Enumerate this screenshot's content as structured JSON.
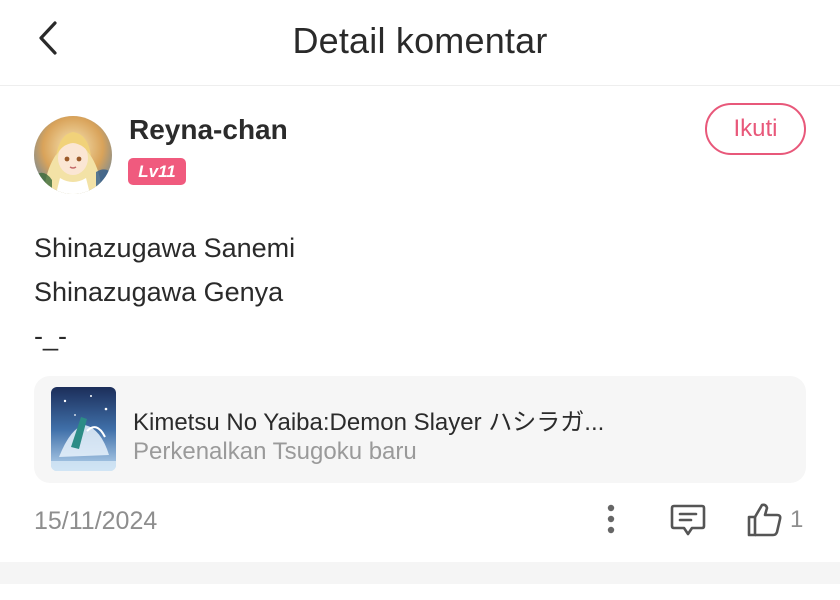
{
  "header": {
    "title": "Detail komentar",
    "back_icon": "chevron-left-icon"
  },
  "comment": {
    "user": {
      "name": "Reyna-chan",
      "level": "Lv11",
      "avatar_icon": "user-avatar"
    },
    "follow_label": "Ikuti",
    "lines": [
      "Shinazugawa Sanemi",
      "Shinazugawa Genya",
      "-_-"
    ],
    "game": {
      "title": "Kimetsu No Yaiba:Demon Slayer ハシラガ...",
      "subtitle": "Perkenalkan Tsugoku baru",
      "thumb_icon": "game-thumbnail"
    },
    "date": "15/11/2024",
    "like_count": "1"
  },
  "colors": {
    "accent": "#e8587a",
    "badge": "#f05a7e",
    "muted_text": "#8e8e8e",
    "card_bg": "#f6f6f6"
  }
}
